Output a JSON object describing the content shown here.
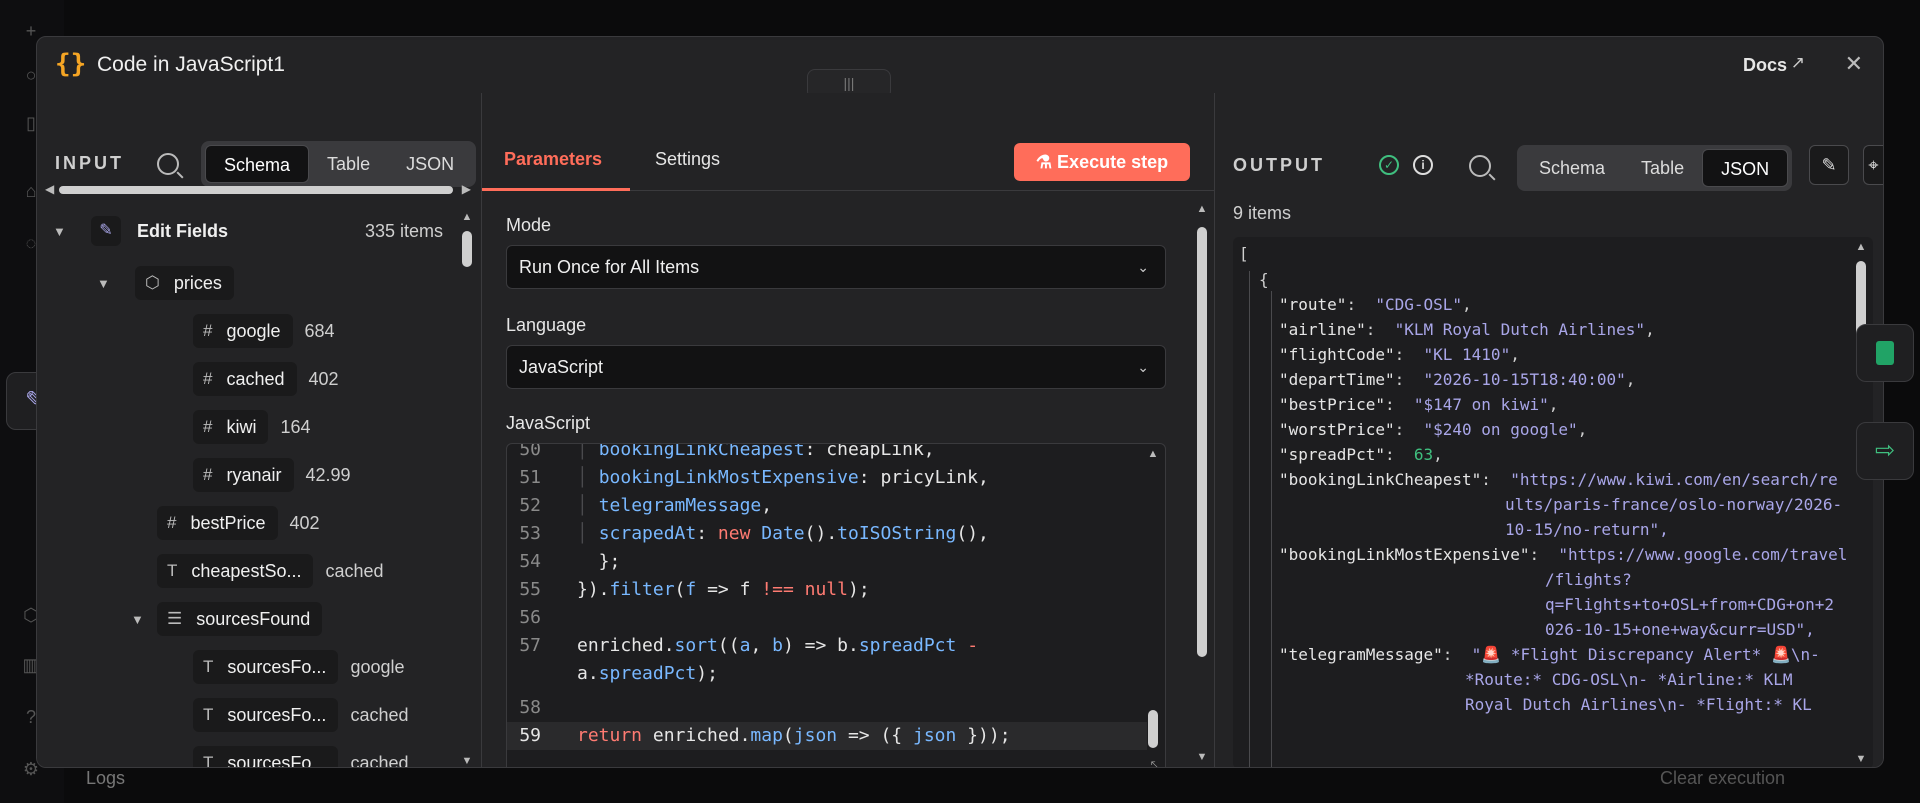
{
  "modal": {
    "title": "Code in JavaScript1",
    "docs_label": "Docs",
    "node_icon": "braces-icon"
  },
  "input": {
    "label": "INPUT",
    "view_tabs": [
      "Schema",
      "Table",
      "JSON"
    ],
    "active_view": "Schema",
    "tree": [
      {
        "label": "Edit Fields",
        "value": "335 items",
        "type": "node",
        "depth": 0
      },
      {
        "label": "prices",
        "value": "",
        "type": "object",
        "depth": 1
      },
      {
        "label": "google",
        "value": "684",
        "type": "number",
        "depth": 2
      },
      {
        "label": "cached",
        "value": "402",
        "type": "number",
        "depth": 2
      },
      {
        "label": "kiwi",
        "value": "164",
        "type": "number",
        "depth": 2
      },
      {
        "label": "ryanair",
        "value": "42.99",
        "type": "number",
        "depth": 2
      },
      {
        "label": "bestPrice",
        "value": "402",
        "type": "number",
        "depth": 1
      },
      {
        "label": "cheapestSo...",
        "value": "cached",
        "type": "string",
        "depth": 1
      },
      {
        "label": "sourcesFound",
        "value": "",
        "type": "array",
        "depth": 1
      },
      {
        "label": "sourcesFo...",
        "value": "google",
        "type": "string",
        "depth": 2
      },
      {
        "label": "sourcesFo...",
        "value": "cached",
        "type": "string",
        "depth": 2
      },
      {
        "label": "sourcesFo...",
        "value": "cached",
        "type": "string",
        "depth": 2
      }
    ]
  },
  "params": {
    "tabs": [
      "Parameters",
      "Settings"
    ],
    "active_tab": "Parameters",
    "execute_label": "Execute step",
    "mode_label": "Mode",
    "mode_value": "Run Once for All Items",
    "language_label": "Language",
    "language_value": "JavaScript",
    "code_label": "JavaScript",
    "code_lines": [
      {
        "n": "50",
        "text": "    bookingLinkCheapest: cheapLink,"
      },
      {
        "n": "51",
        "text": "    bookingLinkMostExpensive: pricyLink,"
      },
      {
        "n": "52",
        "text": "    telegramMessage,"
      },
      {
        "n": "53",
        "text": "    scrapedAt: new Date().toISOString(),"
      },
      {
        "n": "54",
        "text": "  };"
      },
      {
        "n": "55",
        "text": "}).filter(f => f !== null);"
      },
      {
        "n": "56",
        "text": ""
      },
      {
        "n": "57",
        "text": "enriched.sort((a, b) => b.spreadPct -"
      },
      {
        "n": "",
        "text": "a.spreadPct);"
      },
      {
        "n": "58",
        "text": ""
      },
      {
        "n": "59",
        "text": "return enriched.map(json => ({ json }));"
      }
    ]
  },
  "output": {
    "label": "OUTPUT",
    "view_tabs": [
      "Schema",
      "Table",
      "JSON"
    ],
    "active_view": "JSON",
    "items_count": "9 items",
    "json_lines": [
      "[",
      "{",
      "\"route\": \"CDG-OSL\",",
      "\"airline\": \"KLM Royal Dutch Airlines\",",
      "\"flightCode\": \"KL 1410\",",
      "\"departTime\": \"2026-10-15T18:40:00\",",
      "\"bestPrice\": \"$147 on kiwi\",",
      "\"worstPrice\": \"$240 on google\",",
      "\"spreadPct\": 63,",
      "\"bookingLinkCheapest\": \"https://www.kiwi.com/en/search/re",
      "ults/paris-france/oslo-norway/2026-",
      "10-15/no-return\",",
      "\"bookingLinkMostExpensive\": \"https://www.google.com/travel",
      "/flights?",
      "q=Flights+to+OSL+from+CDG+on+2",
      "026-10-15+one+way&curr=USD\",",
      "\"telegramMessage\": \"🚨 *Flight Discrepancy Alert* 🚨\\n-",
      "*Route:* CDG-OSL\\n- *Airline:* KLM",
      "Royal Dutch Airlines\\n- *Flight:* KL"
    ]
  },
  "background": {
    "logs_label": "Logs",
    "clear_label": "Clear execution"
  },
  "colors": {
    "accent": "#ff6d5a",
    "node_icon": "#f5a524",
    "success": "#3fbf7f",
    "json_string": "#a9a6e8"
  }
}
